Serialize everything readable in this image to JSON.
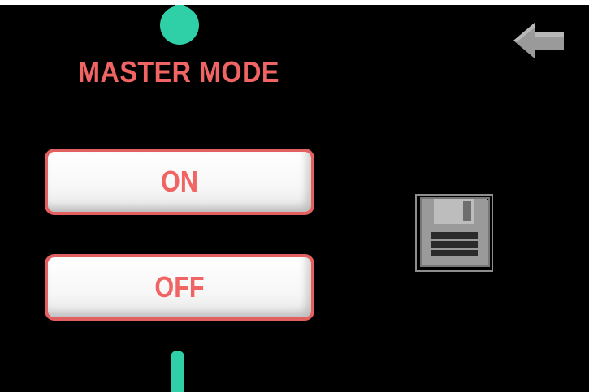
{
  "screen": {
    "title": "MASTER MODE"
  },
  "buttons": {
    "on_label": "ON",
    "off_label": "OFF"
  },
  "icons": {
    "back": "back-arrow-icon",
    "save": "floppy-disk-save-icon"
  },
  "colors": {
    "background": "#000000",
    "accent_teal": "#2fd0a8",
    "label_red": "#f06464",
    "button_border": "#e26060",
    "button_fill": "#ffffff",
    "icon_gray": "#9a9a9a"
  }
}
